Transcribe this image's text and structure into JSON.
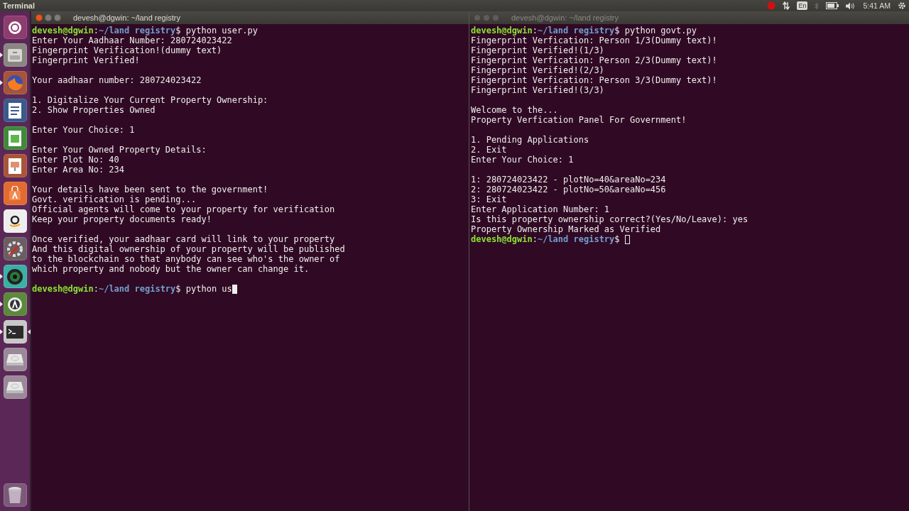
{
  "top_panel": {
    "app_title": "Terminal",
    "keyboard_layout": "En",
    "clock": "5:41 AM",
    "recording": true
  },
  "launcher": {
    "items": [
      {
        "kind": "dash",
        "running": false,
        "active": false
      },
      {
        "kind": "files",
        "running": true,
        "active": false
      },
      {
        "kind": "browser",
        "running": true,
        "active": false
      },
      {
        "kind": "document",
        "running": false,
        "active": false
      },
      {
        "kind": "spreadsheet",
        "running": false,
        "active": false
      },
      {
        "kind": "presentation",
        "running": false,
        "active": false
      },
      {
        "kind": "store",
        "running": false,
        "active": false
      },
      {
        "kind": "shop",
        "running": false,
        "active": false
      },
      {
        "kind": "settings",
        "running": false,
        "active": false
      },
      {
        "kind": "lens",
        "running": true,
        "active": false
      },
      {
        "kind": "updater",
        "running": true,
        "active": false
      },
      {
        "kind": "terminal",
        "running": true,
        "active": true
      },
      {
        "kind": "drive",
        "running": false,
        "active": false
      },
      {
        "kind": "drive",
        "running": false,
        "active": false
      }
    ],
    "trash": {
      "kind": "trash"
    }
  },
  "terminals": [
    {
      "title": "devesh@dgwin: ~/land registry",
      "focused": true,
      "lines": [
        {
          "kind": "prompt",
          "user_host": "devesh@dgwin",
          "separator": ":",
          "path": "~/land registry",
          "symbol": "$",
          "command": "python user.py"
        },
        {
          "kind": "output",
          "text": "Enter Your Aadhaar Number: 280724023422"
        },
        {
          "kind": "output",
          "text": "Fingerprint Verification!(dummy text)"
        },
        {
          "kind": "output",
          "text": "Fingerprint Verified!"
        },
        {
          "kind": "blank"
        },
        {
          "kind": "output",
          "text": "Your aadhaar number: 280724023422"
        },
        {
          "kind": "blank"
        },
        {
          "kind": "output",
          "text": "1. Digitalize Your Current Property Ownership:"
        },
        {
          "kind": "output",
          "text": "2. Show Properties Owned"
        },
        {
          "kind": "blank"
        },
        {
          "kind": "output",
          "text": "Enter Your Choice: 1"
        },
        {
          "kind": "blank"
        },
        {
          "kind": "output",
          "text": "Enter Your Owned Property Details:"
        },
        {
          "kind": "output",
          "text": "Enter Plot No: 40"
        },
        {
          "kind": "output",
          "text": "Enter Area No: 234"
        },
        {
          "kind": "blank"
        },
        {
          "kind": "output",
          "text": "Your details have been sent to the government!"
        },
        {
          "kind": "output",
          "text": "Govt. verification is pending..."
        },
        {
          "kind": "output",
          "text": "Official agents will come to your property for verification"
        },
        {
          "kind": "output",
          "text": "Keep your property documents ready!"
        },
        {
          "kind": "blank"
        },
        {
          "kind": "output",
          "text": "Once verified, your aadhaar card will link to your property"
        },
        {
          "kind": "output",
          "text": "And this digital ownership of your property will be published"
        },
        {
          "kind": "output",
          "text": "to the blockchain so that anybody can see who's the owner of"
        },
        {
          "kind": "output",
          "text": "which property and nobody but the owner can change it."
        },
        {
          "kind": "blank"
        },
        {
          "kind": "prompt",
          "user_host": "devesh@dgwin",
          "separator": ":",
          "path": "~/land registry",
          "symbol": "$",
          "command": "python us",
          "cursor": true
        }
      ]
    },
    {
      "title": "devesh@dgwin: ~/land registry",
      "focused": false,
      "lines": [
        {
          "kind": "prompt",
          "user_host": "devesh@dgwin",
          "separator": ":",
          "path": "~/land registry",
          "symbol": "$",
          "command": "python govt.py"
        },
        {
          "kind": "output",
          "text": "Fingerprint Verfication: Person 1/3(Dummy text)!"
        },
        {
          "kind": "output",
          "text": "Fingerprint Verified!(1/3)"
        },
        {
          "kind": "output",
          "text": "Fingerprint Verfication: Person 2/3(Dummy text)!"
        },
        {
          "kind": "output",
          "text": "Fingerprint Verified!(2/3)"
        },
        {
          "kind": "output",
          "text": "Fingerprint Verfication: Person 3/3(Dummy text)!"
        },
        {
          "kind": "output",
          "text": "Fingerprint Verified!(3/3)"
        },
        {
          "kind": "blank"
        },
        {
          "kind": "output",
          "text": "Welcome to the..."
        },
        {
          "kind": "output",
          "text": "Property Verfication Panel For Government!"
        },
        {
          "kind": "blank"
        },
        {
          "kind": "output",
          "text": "1. Pending Applications"
        },
        {
          "kind": "output",
          "text": "2. Exit"
        },
        {
          "kind": "output",
          "text": "Enter Your Choice: 1"
        },
        {
          "kind": "blank"
        },
        {
          "kind": "output",
          "text": "1: 280724023422 - plotNo=40&areaNo=234"
        },
        {
          "kind": "output",
          "text": "2: 280724023422 - plotNo=50&areaNo=456"
        },
        {
          "kind": "output",
          "text": "3: Exit"
        },
        {
          "kind": "output",
          "text": "Enter Application Number: 1"
        },
        {
          "kind": "output",
          "text": "Is this property ownership correct?(Yes/No/Leave): yes"
        },
        {
          "kind": "output",
          "text": "Property Ownership Marked as Verified"
        },
        {
          "kind": "prompt",
          "user_host": "devesh@dgwin",
          "separator": ":",
          "path": "~/land registry",
          "symbol": "$",
          "cursor": true
        }
      ]
    }
  ]
}
